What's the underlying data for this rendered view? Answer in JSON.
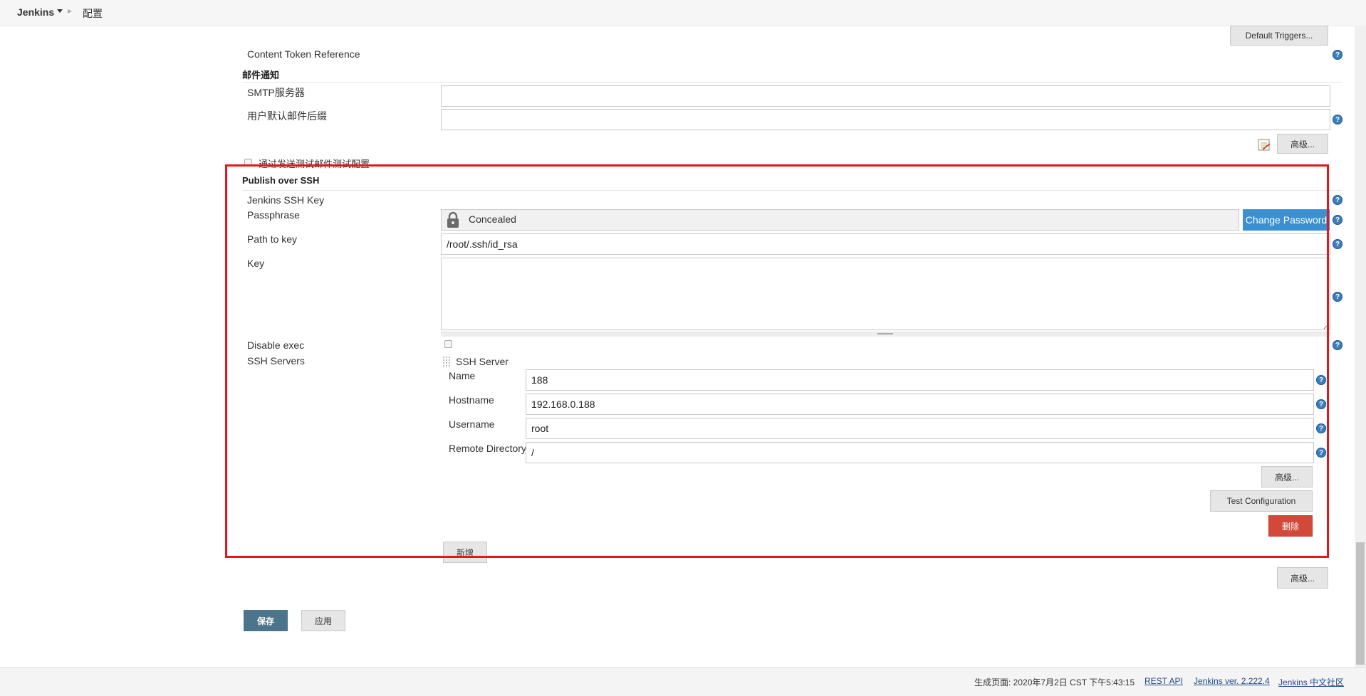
{
  "breadcrumb": {
    "home": "Jenkins",
    "page": "配置"
  },
  "top": {
    "default_triggers": "Default Triggers...",
    "content_token": "Content Token Reference"
  },
  "email": {
    "title": "邮件通知",
    "smtp_label": "SMTP服务器",
    "smtp_value": "",
    "suffix_label": "用户默认邮件后缀",
    "suffix_value": "",
    "advanced": "高级...",
    "test_label": "通过发送测试邮件测试配置"
  },
  "ssh": {
    "title": "Publish over SSH",
    "jenkins_key_label": "Jenkins SSH Key",
    "passphrase_label": "Passphrase",
    "passphrase_value": "Concealed",
    "change_password": "Change Password",
    "path_label": "Path to key",
    "path_value": "/root/.ssh/id_rsa",
    "key_label": "Key",
    "disable_exec_label": "Disable exec",
    "servers_label": "SSH Servers",
    "server": {
      "header": "SSH Server",
      "name_label": "Name",
      "name_value": "188",
      "hostname_label": "Hostname",
      "hostname_value": "192.168.0.188",
      "username_label": "Username",
      "username_value": "root",
      "remote_dir_label": "Remote Directory",
      "remote_dir_value": "/",
      "advanced": "高级...",
      "test_config": "Test Configuration",
      "delete": "删除"
    },
    "add": "新增",
    "advanced": "高级..."
  },
  "actions": {
    "save": "保存",
    "apply": "应用"
  },
  "footer": {
    "generated": "生成页面: 2020年7月2日 CST 下午5:43:15",
    "rest_api": "REST API",
    "version": "Jenkins ver. 2.222.4",
    "community": "Jenkins 中文社区"
  },
  "help_glyph": "?",
  "icons": {
    "lock": "lock-icon",
    "notepad": "notepad-icon",
    "help": "help-icon",
    "drag": "drag-handle-icon"
  }
}
